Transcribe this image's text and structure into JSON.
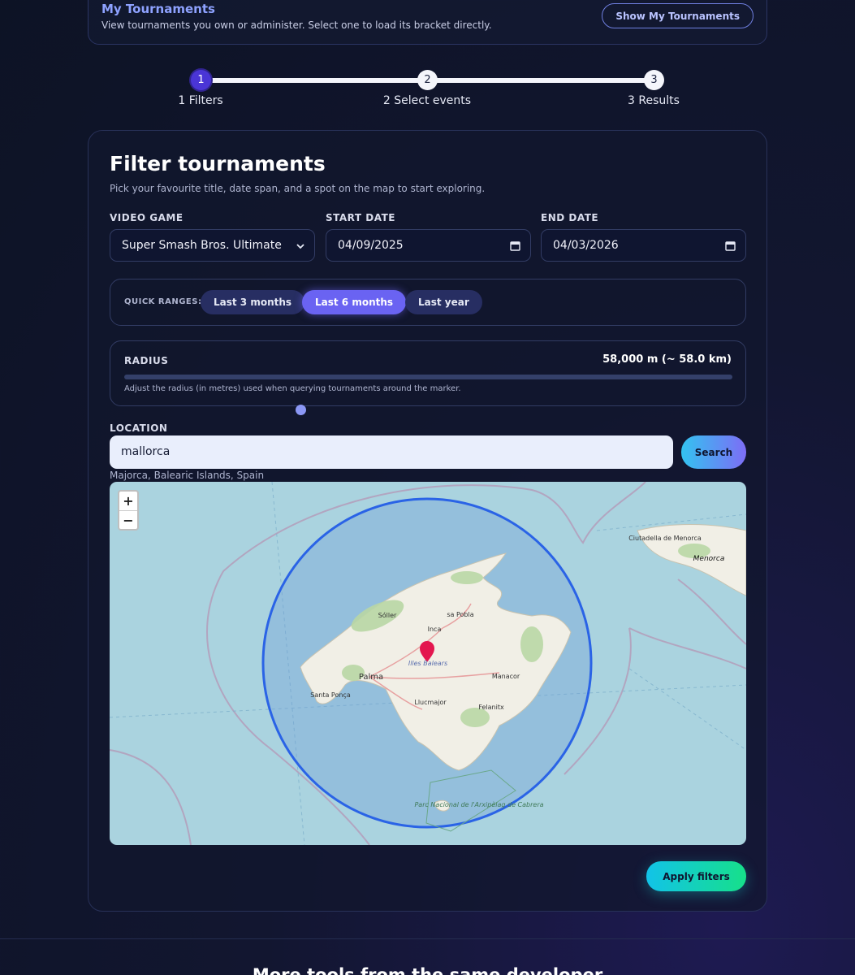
{
  "my_tournaments": {
    "title": "My Tournaments",
    "description": "View tournaments you own or administer. Select one to load its bracket directly.",
    "button": "Show My Tournaments"
  },
  "stepper": {
    "steps": [
      {
        "number": "1",
        "label": "1 Filters",
        "active": true
      },
      {
        "number": "2",
        "label": "2 Select events",
        "active": false
      },
      {
        "number": "3",
        "label": "3 Results",
        "active": false
      }
    ]
  },
  "filters": {
    "title": "Filter tournaments",
    "subtitle": "Pick your favourite title, date span, and a spot on the map to start exploring.",
    "video_game": {
      "label": "VIDEO GAME",
      "value": "Super Smash Bros. Ultimate"
    },
    "start_date": {
      "label": "START DATE",
      "value": "04/09/2025"
    },
    "end_date": {
      "label": "END DATE",
      "value": "04/03/2026"
    },
    "quick_ranges": {
      "label": "QUICK RANGES:",
      "options": [
        "Last 3 months",
        "Last 6 months",
        "Last year"
      ],
      "selected": "Last 6 months"
    },
    "radius": {
      "label": "RADIUS",
      "value_text": "58,000 m (~ 58.0 km)",
      "value_fraction": 0.29,
      "help": "Adjust the radius (in metres) used when querying tournaments around the marker."
    },
    "location": {
      "label": "LOCATION",
      "value": "mallorca",
      "search_button": "Search",
      "result": "Majorca, Balearic Islands, Spain"
    },
    "map": {
      "zoom_in": "+",
      "zoom_out": "−",
      "place_labels": [
        "Ciutadella de Menorca",
        "Menorca",
        "Sóller",
        "sa Pobla",
        "Inca",
        "Illes Balears",
        "Palma",
        "Manacor",
        "Santa Ponça",
        "Llucmajor",
        "Felanitx",
        "Parc Nacional de l'Arxipèlag de Cabrera"
      ]
    },
    "apply_button": "Apply filters"
  },
  "footer": {
    "more_title": "More tools from the same developer"
  }
}
